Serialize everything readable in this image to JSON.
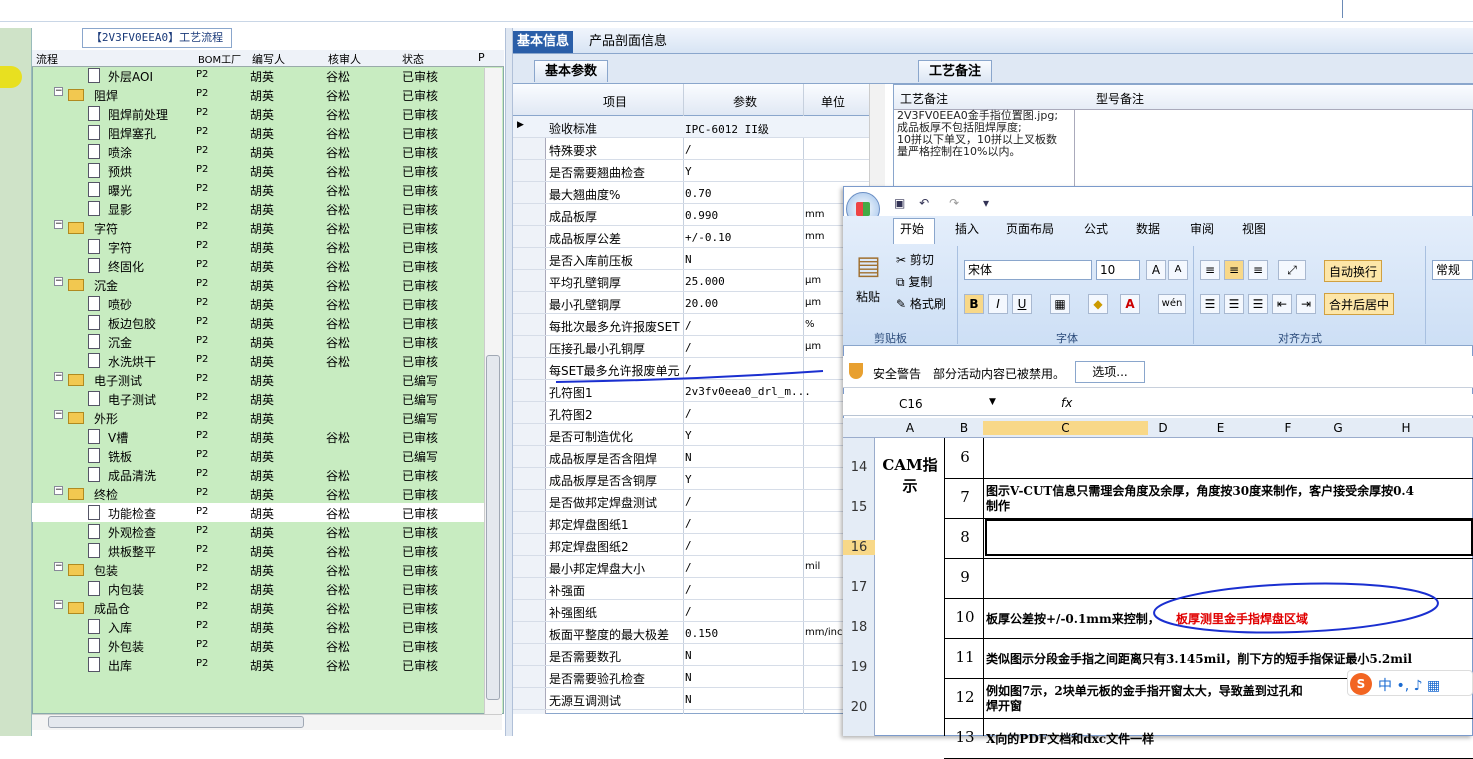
{
  "left_panel": {
    "title": "【2V3FV0EEA0】工艺流程",
    "columns": [
      "流程",
      "BOM工厂",
      "编写人",
      "核审人",
      "状态",
      "P"
    ],
    "rows": [
      {
        "name": "外层AOI",
        "kind": "item",
        "bom": "P2",
        "author": "胡英",
        "reviewer": "谷松",
        "status": "已审核"
      },
      {
        "name": "阻焊",
        "kind": "folder",
        "bom": "P2",
        "author": "胡英",
        "reviewer": "谷松",
        "status": "已审核"
      },
      {
        "name": "阻焊前处理",
        "kind": "item",
        "bom": "P2",
        "author": "胡英",
        "reviewer": "谷松",
        "status": "已审核"
      },
      {
        "name": "阻焊塞孔",
        "kind": "item",
        "bom": "P2",
        "author": "胡英",
        "reviewer": "谷松",
        "status": "已审核"
      },
      {
        "name": "喷涂",
        "kind": "item",
        "bom": "P2",
        "author": "胡英",
        "reviewer": "谷松",
        "status": "已审核"
      },
      {
        "name": "预烘",
        "kind": "item",
        "bom": "P2",
        "author": "胡英",
        "reviewer": "谷松",
        "status": "已审核"
      },
      {
        "name": "曝光",
        "kind": "item",
        "bom": "P2",
        "author": "胡英",
        "reviewer": "谷松",
        "status": "已审核"
      },
      {
        "name": "显影",
        "kind": "item",
        "bom": "P2",
        "author": "胡英",
        "reviewer": "谷松",
        "status": "已审核"
      },
      {
        "name": "字符",
        "kind": "folder",
        "bom": "P2",
        "author": "胡英",
        "reviewer": "谷松",
        "status": "已审核"
      },
      {
        "name": "字符",
        "kind": "item",
        "bom": "P2",
        "author": "胡英",
        "reviewer": "谷松",
        "status": "已审核"
      },
      {
        "name": "终固化",
        "kind": "item",
        "bom": "P2",
        "author": "胡英",
        "reviewer": "谷松",
        "status": "已审核"
      },
      {
        "name": "沉金",
        "kind": "folder",
        "bom": "P2",
        "author": "胡英",
        "reviewer": "谷松",
        "status": "已审核"
      },
      {
        "name": "喷砂",
        "kind": "item",
        "bom": "P2",
        "author": "胡英",
        "reviewer": "谷松",
        "status": "已审核"
      },
      {
        "name": "板边包胶",
        "kind": "item",
        "bom": "P2",
        "author": "胡英",
        "reviewer": "谷松",
        "status": "已审核"
      },
      {
        "name": "沉金",
        "kind": "item",
        "bom": "P2",
        "author": "胡英",
        "reviewer": "谷松",
        "status": "已审核"
      },
      {
        "name": "水洗烘干",
        "kind": "item",
        "bom": "P2",
        "author": "胡英",
        "reviewer": "谷松",
        "status": "已审核"
      },
      {
        "name": "电子测试",
        "kind": "folder",
        "bom": "P2",
        "author": "胡英",
        "reviewer": "",
        "status": "已编写"
      },
      {
        "name": "电子测试",
        "kind": "item",
        "bom": "P2",
        "author": "胡英",
        "reviewer": "",
        "status": "已编写"
      },
      {
        "name": "外形",
        "kind": "folder",
        "bom": "P2",
        "author": "胡英",
        "reviewer": "",
        "status": "已编写"
      },
      {
        "name": "V槽",
        "kind": "item",
        "bom": "P2",
        "author": "胡英",
        "reviewer": "谷松",
        "status": "已审核"
      },
      {
        "name": "铣板",
        "kind": "item",
        "bom": "P2",
        "author": "胡英",
        "reviewer": "",
        "status": "已编写"
      },
      {
        "name": "成品清洗",
        "kind": "item",
        "bom": "P2",
        "author": "胡英",
        "reviewer": "谷松",
        "status": "已审核"
      },
      {
        "name": "终检",
        "kind": "folder",
        "bom": "P2",
        "author": "胡英",
        "reviewer": "谷松",
        "status": "已审核"
      },
      {
        "name": "功能检查",
        "kind": "item",
        "bom": "P2",
        "author": "胡英",
        "reviewer": "谷松",
        "status": "已审核",
        "selected": true
      },
      {
        "name": "外观检查",
        "kind": "item",
        "bom": "P2",
        "author": "胡英",
        "reviewer": "谷松",
        "status": "已审核"
      },
      {
        "name": "烘板整平",
        "kind": "item",
        "bom": "P2",
        "author": "胡英",
        "reviewer": "谷松",
        "status": "已审核"
      },
      {
        "name": "包装",
        "kind": "folder",
        "bom": "P2",
        "author": "胡英",
        "reviewer": "谷松",
        "status": "已审核"
      },
      {
        "name": "内包装",
        "kind": "item",
        "bom": "P2",
        "author": "胡英",
        "reviewer": "谷松",
        "status": "已审核"
      },
      {
        "name": "成品仓",
        "kind": "folder",
        "bom": "P2",
        "author": "胡英",
        "reviewer": "谷松",
        "status": "已审核"
      },
      {
        "name": "入库",
        "kind": "item",
        "bom": "P2",
        "author": "胡英",
        "reviewer": "谷松",
        "status": "已审核"
      },
      {
        "name": "外包装",
        "kind": "item",
        "bom": "P2",
        "author": "胡英",
        "reviewer": "谷松",
        "status": "已审核"
      },
      {
        "name": "出库",
        "kind": "item",
        "bom": "P2",
        "author": "胡英",
        "reviewer": "谷松",
        "status": "已审核"
      }
    ]
  },
  "tabs": {
    "basic": "基本信息",
    "profile": "产品剖面信息"
  },
  "subtabs": {
    "params": "基本参数",
    "notes": "工艺备注"
  },
  "param_grid": {
    "headers": {
      "item": "项目",
      "param": "参数",
      "unit": "单位"
    },
    "rows": [
      {
        "item": "验收标准",
        "param": "IPC-6012 II级",
        "unit": ""
      },
      {
        "item": "特殊要求",
        "param": "/",
        "unit": ""
      },
      {
        "item": "是否需要翘曲检查",
        "param": "Y",
        "unit": ""
      },
      {
        "item": "最大翘曲度%",
        "param": "0.70",
        "unit": ""
      },
      {
        "item": "成品板厚",
        "param": "0.990",
        "unit": "mm"
      },
      {
        "item": "成品板厚公差",
        "param": "+/-0.10",
        "unit": "mm"
      },
      {
        "item": "是否入库前压板",
        "param": "N",
        "unit": ""
      },
      {
        "item": "平均孔壁铜厚",
        "param": "25.000",
        "unit": "μm"
      },
      {
        "item": "最小孔壁铜厚",
        "param": "20.00",
        "unit": "μm"
      },
      {
        "item": "每批次最多允许报废SET",
        "param": "/",
        "unit": "%"
      },
      {
        "item": "压接孔最小孔铜厚",
        "param": "/",
        "unit": "μm"
      },
      {
        "item": "每SET最多允许报废单元",
        "param": "/",
        "unit": ""
      },
      {
        "item": "孔符图1",
        "param": "2v3fv0eea0_drl_m...",
        "unit": ""
      },
      {
        "item": "孔符图2",
        "param": "/",
        "unit": ""
      },
      {
        "item": "是否可制造优化",
        "param": "Y",
        "unit": ""
      },
      {
        "item": "成品板厚是否含阻焊",
        "param": "N",
        "unit": ""
      },
      {
        "item": "成品板厚是否含铜厚",
        "param": "Y",
        "unit": ""
      },
      {
        "item": "是否做邦定焊盘测试",
        "param": "/",
        "unit": ""
      },
      {
        "item": "邦定焊盘图纸1",
        "param": "/",
        "unit": ""
      },
      {
        "item": "邦定焊盘图纸2",
        "param": "/",
        "unit": ""
      },
      {
        "item": "最小邦定焊盘大小",
        "param": "/",
        "unit": "mil"
      },
      {
        "item": "补强面",
        "param": "/",
        "unit": ""
      },
      {
        "item": "补强图纸",
        "param": "/",
        "unit": ""
      },
      {
        "item": "板面平整度的最大极差",
        "param": "0.150",
        "unit": "mm/inc"
      },
      {
        "item": "是否需要数孔",
        "param": "N",
        "unit": ""
      },
      {
        "item": "是否需要验孔检查",
        "param": "N",
        "unit": ""
      },
      {
        "item": "无源互调测试",
        "param": "N",
        "unit": ""
      }
    ]
  },
  "notes": {
    "col1": "工艺备注",
    "col2": "型号备注",
    "lines": [
      "2V3FV0EEA0金手指位置图.jpg;",
      "成品板厚不包括阻焊厚度;",
      "10拼以下单叉，10拼以上叉板数",
      "量严格控制在10%以内。"
    ]
  },
  "excel": {
    "qat": "▾",
    "tabs": [
      "开始",
      "插入",
      "页面布局",
      "公式",
      "数据",
      "审阅",
      "视图"
    ],
    "paste": "粘贴",
    "cut": "剪切",
    "copy": "复制",
    "format_painter": "格式刷",
    "font": "宋体",
    "size": "10",
    "bold": "B",
    "italic": "I",
    "underline": "U",
    "wrap": "自动换行",
    "merge": "合并后居中",
    "number_format": "常规",
    "group_clipboard": "剪贴板",
    "group_font": "字体",
    "group_align": "对齐方式",
    "security_title": "安全警告",
    "security_msg": "部分活动内容已被禁用。",
    "options": "选项...",
    "cell_ref": "C16",
    "fx": "fx",
    "col_headers": [
      "A",
      "B",
      "C",
      "D",
      "E",
      "F",
      "G",
      "H"
    ],
    "row_numbers": [
      "14",
      "15",
      "16",
      "17",
      "18",
      "19",
      "20"
    ],
    "cam_label": "CAM指示",
    "rows": [
      {
        "b": "6",
        "text": ""
      },
      {
        "b": "7",
        "text": "图示V-CUT信息只需理会角度及余厚，角度按30度来制作，客户接受余厚按0.4",
        "text2": "制作"
      },
      {
        "b": "8",
        "text": ""
      },
      {
        "b": "9",
        "text": ""
      },
      {
        "b": "10",
        "text": "板厚公差按+/-0.1mm来控制，",
        "red": "板厚测里金手指焊盘区域"
      },
      {
        "b": "11",
        "text": "类似图示分段金手指之间距离只有3.145mil，削下方的短手指保证最小5.2mil"
      },
      {
        "b": "12",
        "text": "例如图7示，2块单元板的金手指开窗太大，导致盖到过孔和",
        "text2": "焊开窗"
      },
      {
        "b": "13",
        "text": "X向的PDF文档和dxc文件一样"
      }
    ],
    "ime_text": "中 •, ♪ ▦"
  },
  "colors": {
    "tree_bg": "#c8ecc1",
    "tab_active": "#2a5ea8",
    "red_text": "#e00000",
    "annotation": "#1a2fd0"
  }
}
